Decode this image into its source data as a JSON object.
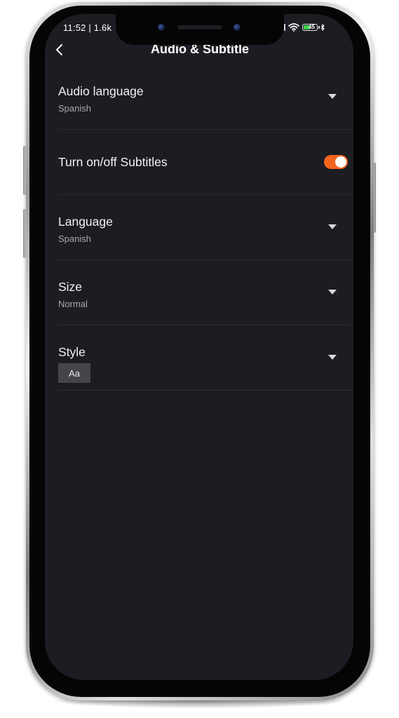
{
  "status_bar": {
    "time": "11:52 | 1.6k",
    "battery_level": "45"
  },
  "header": {
    "title": "Audio & Subtitle",
    "back_icon": "chevron-left-icon"
  },
  "settings": {
    "audio_language": {
      "label": "Audio language",
      "value": "Spanish"
    },
    "subtitles_toggle": {
      "label": "Turn on/off Subtitles",
      "on": true
    },
    "language": {
      "label": "Language",
      "value": "Spanish"
    },
    "size": {
      "label": "Size",
      "value": "Normal"
    },
    "style": {
      "label": "Style",
      "value": "Aa"
    }
  },
  "colors": {
    "background": "#1c1c23",
    "accent_toggle": "#f4641f",
    "battery_fill": "#3fd14a"
  }
}
